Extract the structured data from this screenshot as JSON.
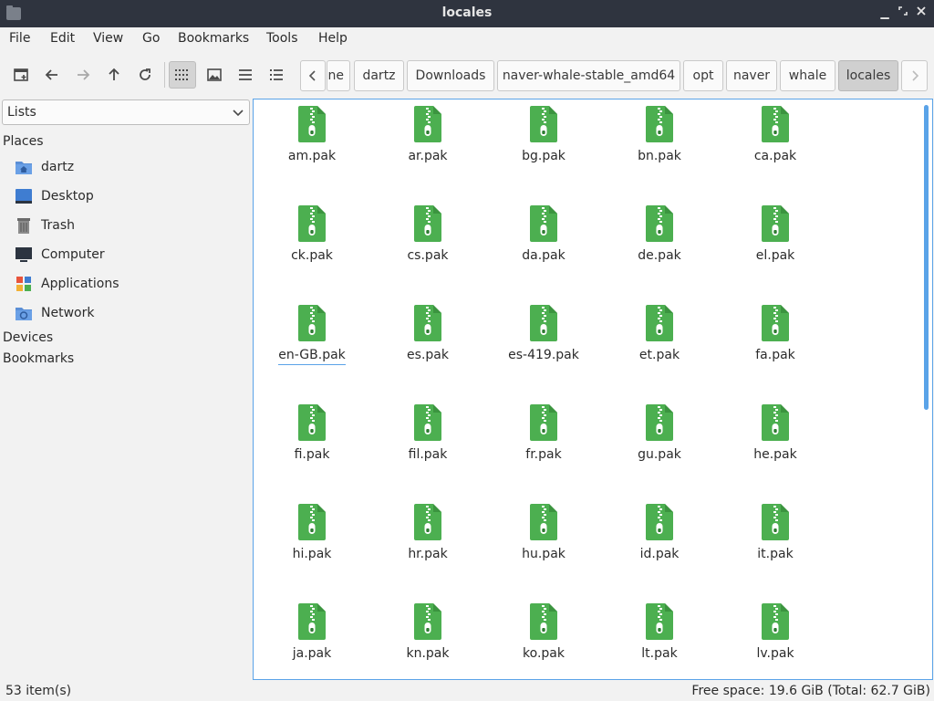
{
  "window": {
    "title": "locales"
  },
  "menubar": [
    "File",
    "Edit",
    "View",
    "Go",
    "Bookmarks",
    "Tools",
    "Help"
  ],
  "toolbar": {
    "buttons": [
      "new-tab-icon",
      "back-icon",
      "forward-icon",
      "up-icon",
      "reload-icon",
      "icon-view-icon",
      "thumbnail-view-icon",
      "compact-view-icon",
      "detailed-list-icon"
    ],
    "active_view": "icon-view"
  },
  "breadcrumb": {
    "items": [
      "ne",
      "dartz",
      "Downloads",
      "naver-whale-stable_amd64",
      "opt",
      "naver",
      "whale",
      "locales"
    ],
    "current": "locales"
  },
  "sidebar": {
    "selector": "Lists",
    "places_label": "Places",
    "places": [
      {
        "label": "dartz",
        "icon": "home-folder-icon"
      },
      {
        "label": "Desktop",
        "icon": "desktop-icon"
      },
      {
        "label": "Trash",
        "icon": "trash-icon"
      },
      {
        "label": "Computer",
        "icon": "computer-icon"
      },
      {
        "label": "Applications",
        "icon": "applications-icon"
      },
      {
        "label": "Network",
        "icon": "network-icon"
      }
    ],
    "devices_label": "Devices",
    "bookmarks_label": "Bookmarks"
  },
  "files": [
    "am.pak",
    "ar.pak",
    "bg.pak",
    "bn.pak",
    "ca.pak",
    "ck.pak",
    "cs.pak",
    "da.pak",
    "de.pak",
    "el.pak",
    "en-GB.pak",
    "es.pak",
    "es-419.pak",
    "et.pak",
    "fa.pak",
    "fi.pak",
    "fil.pak",
    "fr.pak",
    "gu.pak",
    "he.pak",
    "hi.pak",
    "hr.pak",
    "hu.pak",
    "id.pak",
    "it.pak",
    "ja.pak",
    "kn.pak",
    "ko.pak",
    "lt.pak",
    "lv.pak"
  ],
  "focused_file": "en-GB.pak",
  "status": {
    "items": "53 item(s)",
    "free_space": "Free space: 19.6 GiB (Total: 62.7 GiB)"
  },
  "colors": {
    "archive_green": "#4caf50",
    "archive_dark": "#2e7d32",
    "accent": "#5aa3e8",
    "titlebar": "#2f343f"
  }
}
